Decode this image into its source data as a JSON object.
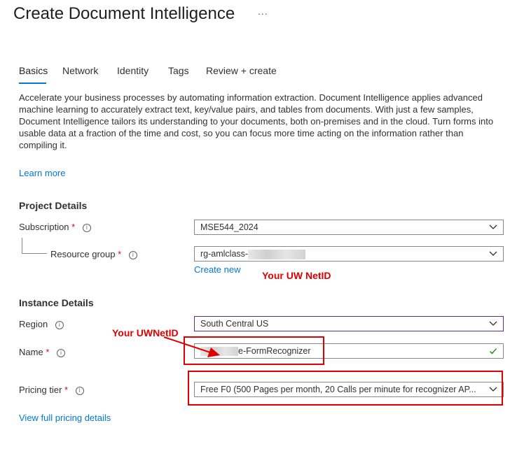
{
  "page": {
    "title": "Create Document Intelligence",
    "more_label": "..."
  },
  "tabs": [
    {
      "label": "Basics",
      "active": true
    },
    {
      "label": "Network"
    },
    {
      "label": "Identity"
    },
    {
      "label": "Tags"
    },
    {
      "label": "Review + create"
    }
  ],
  "description": "Accelerate your business processes by automating information extraction. Document Intelligence applies advanced machine learning to accurately extract text, key/value pairs, and tables from documents. With just a few samples, Document Intelligence tailors its understanding to your documents, both on-premises and in the cloud. Turn forms into usable data at a fraction of the time and cost, so you can focus more time acting on the information rather than compiling it.",
  "learn_more": "Learn more",
  "project_details": {
    "heading": "Project Details",
    "subscription": {
      "label": "Subscription",
      "required": "*",
      "value": "MSE544_2024"
    },
    "resource_group": {
      "label": "Resource group",
      "required": "*",
      "value": "rg-amlclass-",
      "create_new": "Create new"
    }
  },
  "instance_details": {
    "heading": "Instance Details",
    "region": {
      "label": "Region",
      "value": "South Central US"
    },
    "name": {
      "label": "Name",
      "required": "*",
      "value": "e-FormRecognizer"
    },
    "pricing_tier": {
      "label": "Pricing tier",
      "required": "*",
      "value": "Free F0 (500 Pages per month, 20 Calls per minute for recognizer AP..."
    }
  },
  "view_pricing": "View full pricing details",
  "annotations": {
    "netid_1": "Your UW NetID",
    "netid_2": "Your UWNetID"
  },
  "colors": {
    "accent": "#0078d4",
    "required": "#c50f1f",
    "annotation": "#e00000",
    "focus_border": "#5c2d91"
  },
  "icons": {
    "info": "info-icon",
    "chevron": "chevron-down-icon",
    "check": "check-icon"
  }
}
